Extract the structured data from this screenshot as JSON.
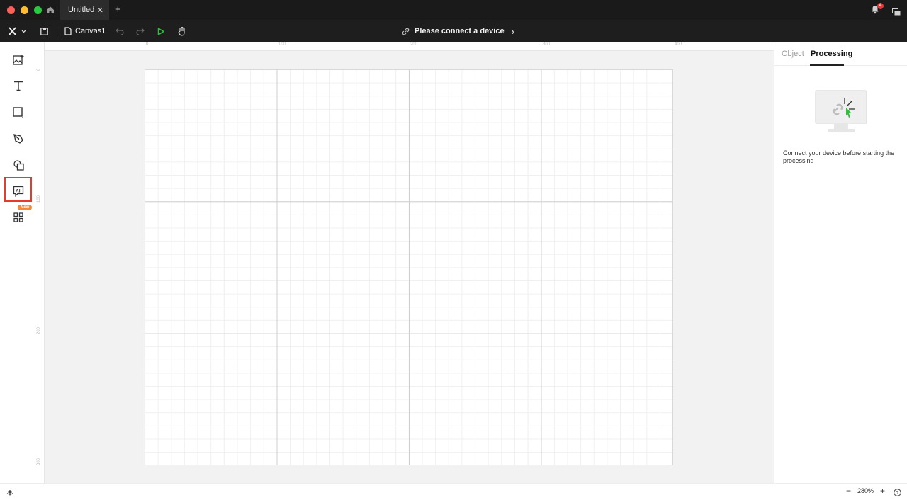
{
  "titlebar": {
    "tab_title": "Untitled",
    "tab_close": "✕",
    "new_tab": "+",
    "notification_count": "4"
  },
  "toolbar": {
    "canvas_name": "Canvas1",
    "connect_label": "Please connect a device",
    "connect_chevron": "›"
  },
  "left_tools": {
    "new_badge": "New"
  },
  "rulers": {
    "top": [
      "0",
      "100",
      "200",
      "300",
      "400"
    ],
    "left": [
      "0",
      "100",
      "200",
      "300"
    ]
  },
  "right_panel": {
    "tab_object": "Object",
    "tab_processing": "Processing",
    "message": "Connect your device before starting the processing"
  },
  "status": {
    "zoom_level": "280%",
    "zoom_out": "−",
    "zoom_in": "+"
  },
  "colors": {
    "titlebar_bg": "#1a1a1a",
    "toolbar_bg": "#1e1e1e",
    "highlight": "#e53b2d",
    "new_badge": "#f5893a",
    "play_green": "#2fbf3a"
  }
}
